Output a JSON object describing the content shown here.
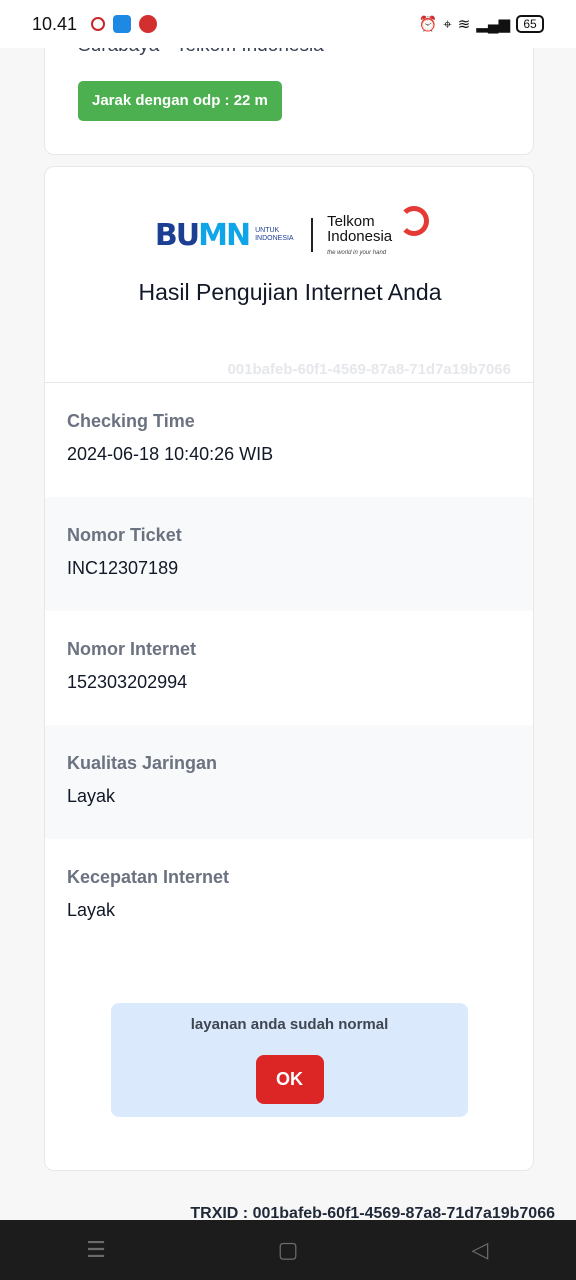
{
  "status_bar": {
    "time": "10.41",
    "battery": "65"
  },
  "top_card": {
    "location": "Surabaya - Telkom Indonesia",
    "distance_badge": "Jarak dengan odp : 22 m"
  },
  "logos": {
    "bumn_mark_a": "BU",
    "bumn_mark_b": "MN",
    "bumn_sub": "UNTUK INDONESIA",
    "telkom_name": "Telkom Indonesia",
    "telkom_tagline": "the world in your hand"
  },
  "result": {
    "title": "Hasil Pengujian Internet Anda",
    "ticket_id": "001bafeb-60f1-4569-87a8-71d7a19b7066",
    "rows": [
      {
        "label": "Checking Time",
        "value": "2024-06-18 10:40:26 WIB"
      },
      {
        "label": "Nomor Ticket",
        "value": "INC12307189"
      },
      {
        "label": "Nomor Internet",
        "value": "152303202994"
      },
      {
        "label": "Kualitas Jaringan",
        "value": "Layak"
      },
      {
        "label": "Kecepatan Internet",
        "value": "Layak"
      }
    ]
  },
  "alert": {
    "message": "layanan anda sudah normal",
    "ok_label": "OK"
  },
  "trxid": "TRXID : 001bafeb-60f1-4569-87a8-71d7a19b7066",
  "nav": {
    "menu_icon": "menu-icon",
    "home_icon": "home-icon",
    "back_icon": "back-icon"
  }
}
